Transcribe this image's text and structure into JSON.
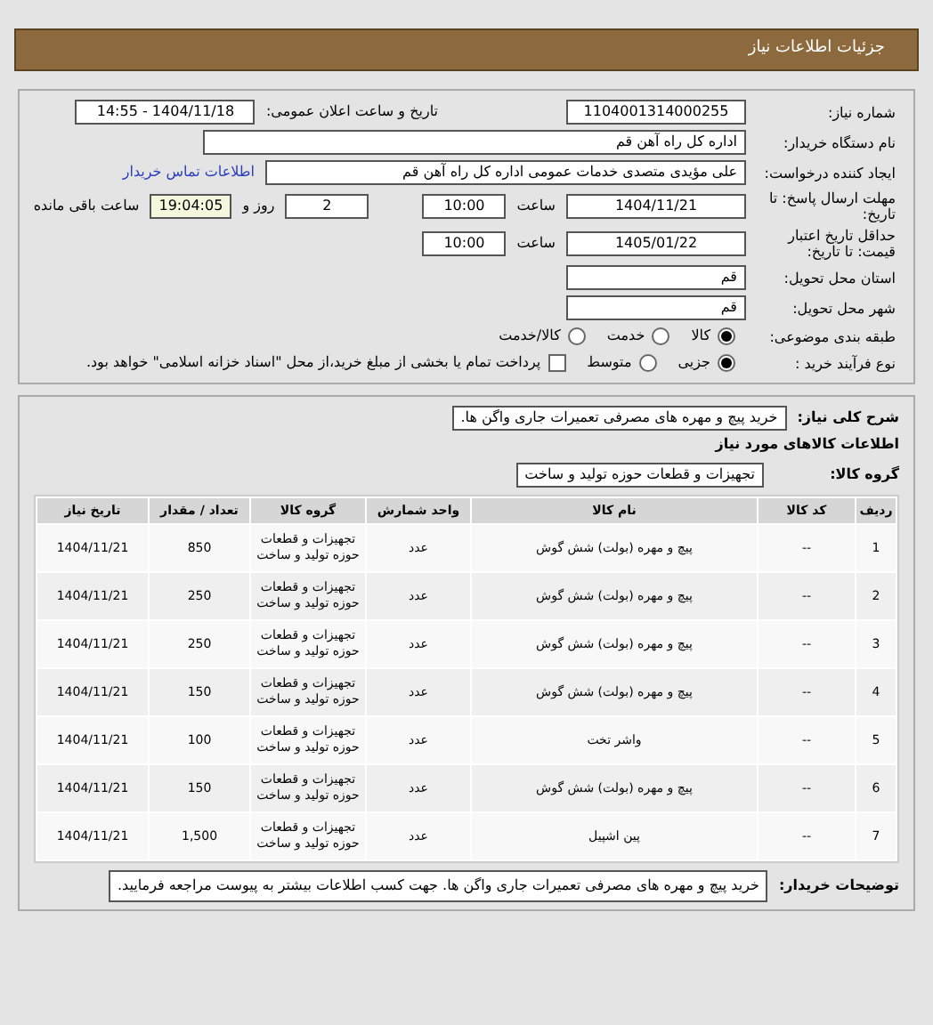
{
  "header": {
    "title": "جزئیات اطلاعات نیاز"
  },
  "need_number": {
    "label": "شماره نیاز:",
    "value": "1104001314000255"
  },
  "announce": {
    "label": "تاریخ و ساعت اعلان عمومی:",
    "value": "1404/11/18 - 14:55"
  },
  "buyer": {
    "label": "نام دستگاه خریدار:",
    "value": "اداره کل  راه آهن قم"
  },
  "creator": {
    "label": "ایجاد کننده درخواست:",
    "value": "علی مؤیدی متصدی خدمات عمومی اداره کل  راه آهن قم",
    "link": "اطلاعات تماس خریدار"
  },
  "deadline": {
    "label": "مهلت ارسال پاسخ: تا تاریخ:",
    "date": "1404/11/21",
    "time_label": "ساعت",
    "time": "10:00",
    "days": "2",
    "days_label": "روز و",
    "remaining": "19:04:05",
    "remaining_label": "ساعت باقی مانده"
  },
  "validity": {
    "label": "حداقل تاریخ اعتبار قیمت: تا تاریخ:",
    "date": "1405/01/22",
    "time_label": "ساعت",
    "time": "10:00"
  },
  "province": {
    "label": "استان محل تحویل:",
    "value": "قم"
  },
  "city": {
    "label": "شهر محل تحویل:",
    "value": "قم"
  },
  "category": {
    "label": "طبقه بندی موضوعی:",
    "options": [
      {
        "label": "کالا",
        "selected": true
      },
      {
        "label": "خدمت",
        "selected": false
      },
      {
        "label": "کالا/خدمت",
        "selected": false
      }
    ]
  },
  "process": {
    "label": "نوع فرآیند خرید :",
    "options": [
      {
        "label": "جزیی",
        "selected": true
      },
      {
        "label": "متوسط",
        "selected": false
      }
    ],
    "treasury": {
      "label": "پرداخت تمام یا بخشی از مبلغ خرید،از محل \"اسناد خزانه اسلامی\" خواهد بود.",
      "checked": false
    }
  },
  "summary": {
    "label": "شرح کلی نیاز:",
    "value": "خرید پیچ و مهره های مصرفی تعمیرات جاری واگن ها."
  },
  "goods_title": "اطلاعات کالاهای مورد نیاز",
  "group": {
    "label": "گروه کالا:",
    "value": "تجهیزات و قطعات حوزه تولید و ساخت"
  },
  "table": {
    "columns": [
      "ردیف",
      "کد کالا",
      "نام کالا",
      "واحد شمارش",
      "گروه کالا",
      "تعداد / مقدار",
      "تاریخ نیاز"
    ],
    "rows": [
      [
        "1",
        "--",
        "پیچ و مهره (بولت) شش گوش",
        "عدد",
        "تجهیزات و قطعات حوزه تولید و ساخت",
        "850",
        "1404/11/21"
      ],
      [
        "2",
        "--",
        "پیچ و مهره (بولت) شش گوش",
        "عدد",
        "تجهیزات و قطعات حوزه تولید و ساخت",
        "250",
        "1404/11/21"
      ],
      [
        "3",
        "--",
        "پیچ و مهره (بولت) شش گوش",
        "عدد",
        "تجهیزات و قطعات حوزه تولید و ساخت",
        "250",
        "1404/11/21"
      ],
      [
        "4",
        "--",
        "پیچ و مهره (بولت) شش گوش",
        "عدد",
        "تجهیزات و قطعات حوزه تولید و ساخت",
        "150",
        "1404/11/21"
      ],
      [
        "5",
        "--",
        "واشر تخت",
        "عدد",
        "تجهیزات و قطعات حوزه تولید و ساخت",
        "100",
        "1404/11/21"
      ],
      [
        "6",
        "--",
        "پیچ و مهره (بولت) شش گوش",
        "عدد",
        "تجهیزات و قطعات حوزه تولید و ساخت",
        "150",
        "1404/11/21"
      ],
      [
        "7",
        "--",
        "پین اشپیل",
        "عدد",
        "تجهیزات و قطعات حوزه تولید و ساخت",
        "1,500",
        "1404/11/21"
      ]
    ]
  },
  "notes": {
    "label": "توضیحات خریدار:",
    "value": "خرید پیچ و مهره های مصرفی تعمیرات جاری واگن ها. جهت کسب اطلاعات بیشتر به پیوست مراجعه فرمایید."
  }
}
